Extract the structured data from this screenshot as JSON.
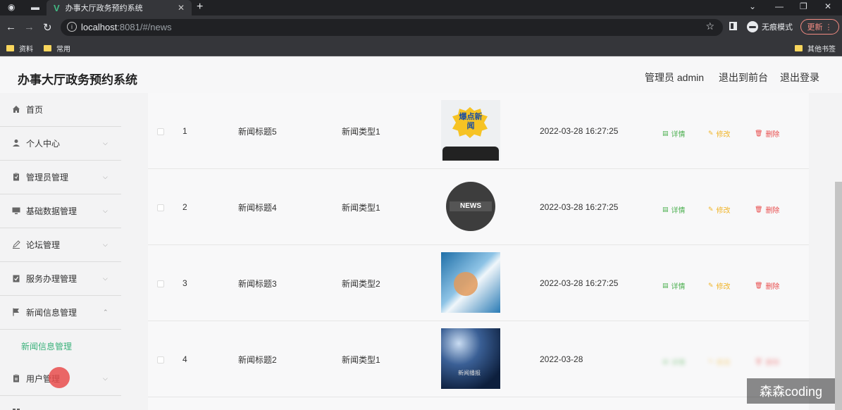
{
  "browser": {
    "tab_title": "办事大厅政务预约系统",
    "url_host": "localhost",
    "url_rest": ":8081/#/news",
    "incognito_label": "无痕模式",
    "update_label": "更新",
    "bookmarks": [
      "资料",
      "常用"
    ],
    "other_bookmarks": "其他书签"
  },
  "app": {
    "title": "办事大厅政务预约系统",
    "user_label": "管理员 admin",
    "front_label": "退出到前台",
    "logout_label": "退出登录"
  },
  "sidebar": {
    "items": [
      {
        "label": "首页",
        "icon": "home-icon"
      },
      {
        "label": "个人中心",
        "icon": "user-icon"
      },
      {
        "label": "管理员管理",
        "icon": "clipboard-icon"
      },
      {
        "label": "基础数据管理",
        "icon": "monitor-icon"
      },
      {
        "label": "论坛管理",
        "icon": "edit-icon"
      },
      {
        "label": "服务办理管理",
        "icon": "checklist-icon"
      },
      {
        "label": "新闻信息管理",
        "icon": "flag-icon"
      },
      {
        "label": "用户管理",
        "icon": "document-icon"
      }
    ],
    "sub_item": "新闻信息管理"
  },
  "table": {
    "rows": [
      {
        "index": "1",
        "title": "新闻标题5",
        "type": "新闻类型1",
        "date": "2022-03-28 16:27:25",
        "thumb_text": "爆点新闻"
      },
      {
        "index": "2",
        "title": "新闻标题4",
        "type": "新闻类型1",
        "date": "2022-03-28 16:27:25",
        "thumb_text": "NEWS"
      },
      {
        "index": "3",
        "title": "新闻标题3",
        "type": "新闻类型2",
        "date": "2022-03-28 16:27:25",
        "thumb_text": ""
      },
      {
        "index": "4",
        "title": "新闻标题2",
        "type": "新闻类型1",
        "date": "2022-03-28",
        "thumb_text": "新闻播报"
      }
    ],
    "actions": {
      "detail": "详情",
      "edit": "修改",
      "delete": "删除"
    }
  },
  "watermark": "森森coding",
  "colors": {
    "accent": "#3bb27b",
    "detail": "#4caf50",
    "edit": "#f0b429",
    "delete": "#e84c4c"
  }
}
